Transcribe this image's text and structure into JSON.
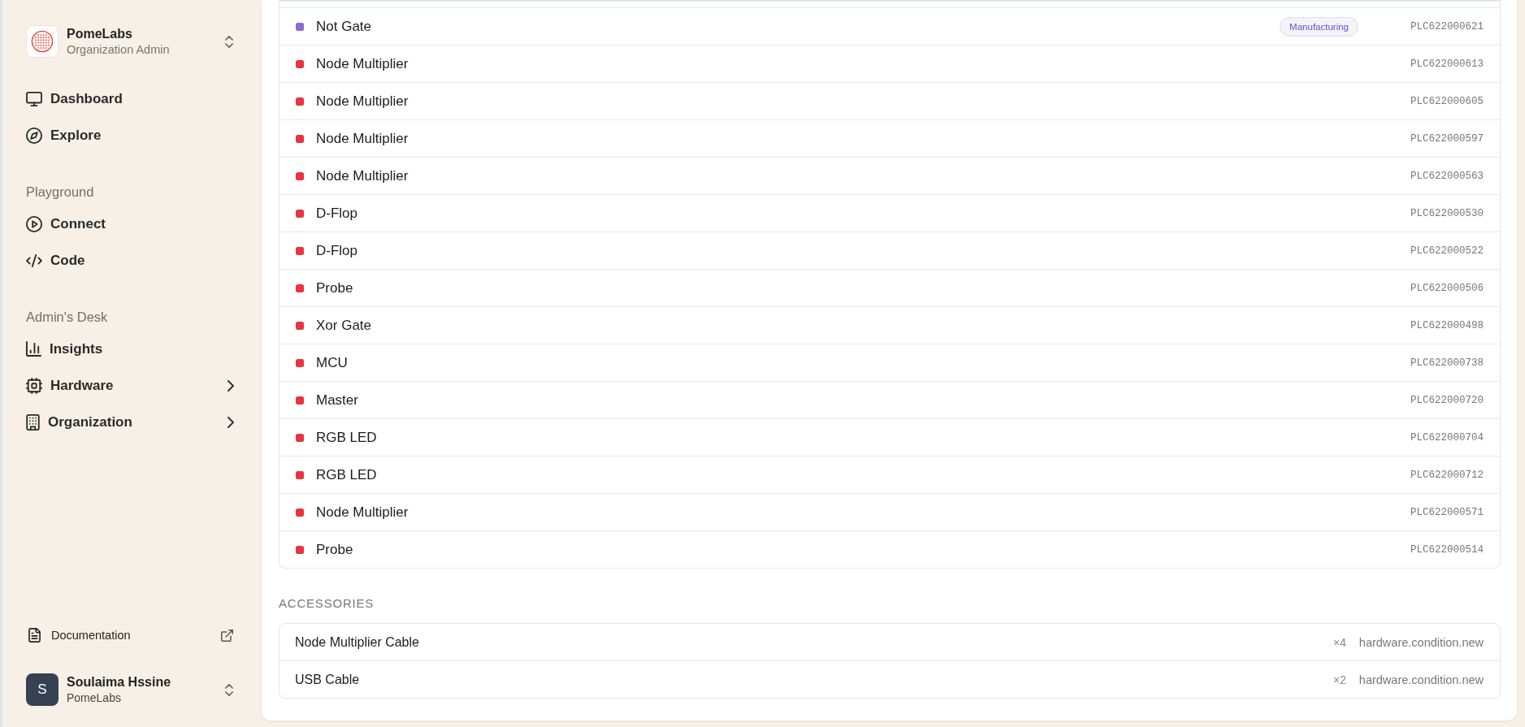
{
  "sidebar": {
    "organization": {
      "name": "PomeLabs",
      "role": "Organization Admin"
    },
    "sections": [
      {
        "items": [
          {
            "label": "Dashboard",
            "selected": false,
            "expandable": false
          },
          {
            "label": "Explore",
            "selected": false,
            "expandable": false
          }
        ]
      },
      {
        "title": "Playground",
        "items": [
          {
            "label": "Connect",
            "selected": false,
            "expandable": false
          },
          {
            "label": "Code",
            "selected": false,
            "expandable": false
          }
        ]
      },
      {
        "title": "Admin's Desk",
        "items": [
          {
            "label": "Insights",
            "selected": false,
            "expandable": false
          },
          {
            "label": "Hardware",
            "selected": false,
            "expandable": true
          },
          {
            "label": "Organization",
            "selected": false,
            "expandable": true
          }
        ]
      }
    ],
    "documentation": {
      "label": "Documentation"
    },
    "user": {
      "initial": "S",
      "name": "Soulaima Hssine",
      "organization": "PomeLabs"
    }
  },
  "devices": {
    "rows": [
      {
        "name": "Not Gate",
        "color": "#8b6ad9",
        "badge": "Manufacturing",
        "serial": "PLC622000621"
      },
      {
        "name": "Node Multiplier",
        "color": "#e8343e",
        "serial": "PLC622000613"
      },
      {
        "name": "Node Multiplier",
        "color": "#e8343e",
        "serial": "PLC622000605"
      },
      {
        "name": "Node Multiplier",
        "color": "#e8343e",
        "serial": "PLC622000597"
      },
      {
        "name": "Node Multiplier",
        "color": "#e8343e",
        "serial": "PLC622000563"
      },
      {
        "name": "D-Flop",
        "color": "#e8343e",
        "serial": "PLC622000530"
      },
      {
        "name": "D-Flop",
        "color": "#e8343e",
        "serial": "PLC622000522"
      },
      {
        "name": "Probe",
        "color": "#e8343e",
        "serial": "PLC622000506"
      },
      {
        "name": "Xor Gate",
        "color": "#e8343e",
        "serial": "PLC622000498"
      },
      {
        "name": "MCU",
        "color": "#e8343e",
        "serial": "PLC622000738"
      },
      {
        "name": "Master",
        "color": "#e8343e",
        "serial": "PLC622000720"
      },
      {
        "name": "RGB LED",
        "color": "#e8343e",
        "serial": "PLC622000704"
      },
      {
        "name": "RGB LED",
        "color": "#e8343e",
        "serial": "PLC622000712"
      },
      {
        "name": "Node Multiplier",
        "color": "#e8343e",
        "serial": "PLC622000571"
      },
      {
        "name": "Probe",
        "color": "#e8343e",
        "serial": "PLC622000514"
      }
    ]
  },
  "accessories": {
    "title": "ACCESSORIES",
    "items": [
      {
        "name": "Node Multiplier Cable",
        "quantity": "×4",
        "condition": "hardware.condition.new"
      },
      {
        "name": "USB Cable",
        "quantity": "×2",
        "condition": "hardware.condition.new"
      }
    ]
  }
}
